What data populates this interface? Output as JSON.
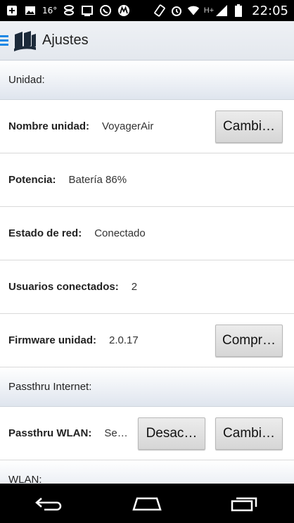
{
  "status_bar": {
    "temperature": "16°",
    "network_type": "H+",
    "time": "22:05",
    "icons": [
      "add-box-icon",
      "image-icon",
      "link-icon",
      "cast-icon",
      "whatsapp-icon",
      "motorola-icon",
      "rotate-icon",
      "alarm-icon",
      "wifi-icon",
      "signal-icon",
      "battery-icon"
    ]
  },
  "action_bar": {
    "title": "Ajustes"
  },
  "sections": {
    "unidad": {
      "header": "Unidad:"
    },
    "passthru_internet": {
      "header": "Passthru Internet:"
    },
    "wlan": {
      "header": "WLAN:"
    }
  },
  "rows": {
    "nombre_unidad": {
      "label": "Nombre unidad:",
      "value": "VoyagerAir",
      "button": "Cambi…"
    },
    "potencia": {
      "label": "Potencia:",
      "value": "Batería 86%"
    },
    "estado_red": {
      "label": "Estado de red:",
      "value": "Conectado"
    },
    "usuarios": {
      "label": "Usuarios conectados:",
      "value": "2"
    },
    "firmware": {
      "label": "Firmware unidad:",
      "value": "2.0.17",
      "button": "Compr…"
    },
    "passthru_wlan": {
      "label": "Passthru WLAN:",
      "value": "Seb…",
      "button1": "Desac…",
      "button2": "Cambi…"
    }
  },
  "colors": {
    "accent": "#1e88e5",
    "header_bg": "#dfe5ee",
    "status_bg": "#000000"
  }
}
